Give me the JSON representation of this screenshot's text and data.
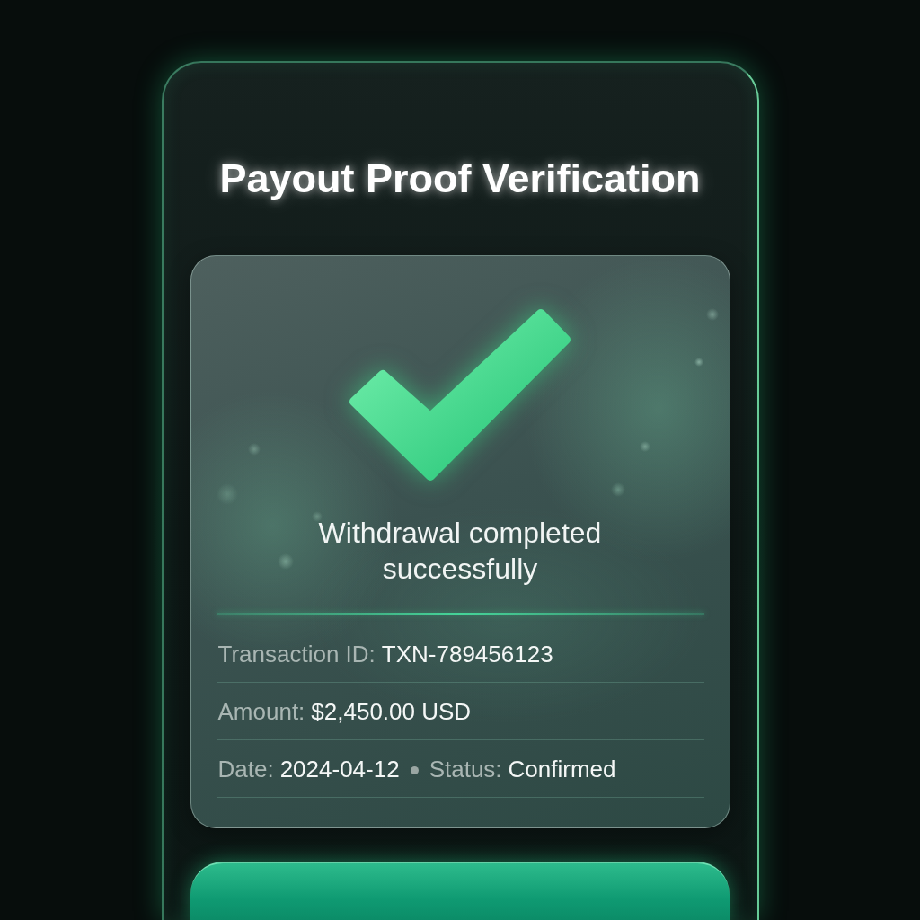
{
  "title": "Payout Proof Verification",
  "status_card": {
    "message": "Withdrawal completed successfully",
    "details": [
      {
        "fields": [
          {
            "label": "Transaction ID:",
            "value": "TXN-789456123"
          }
        ]
      },
      {
        "fields": [
          {
            "label": "Amount:",
            "value": "$2,450.00 USD"
          }
        ]
      },
      {
        "fields": [
          {
            "label": "Date:",
            "value": "2024-04-12"
          },
          {
            "label": "Status:",
            "value": "Confirmed"
          }
        ]
      }
    ]
  },
  "action_button": {
    "kind": "primary"
  }
}
